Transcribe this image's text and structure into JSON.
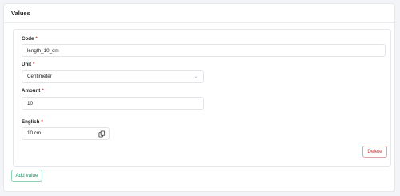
{
  "section": {
    "title": "Values"
  },
  "form": {
    "code": {
      "label": "Code",
      "required_mark": "*",
      "value": "length_10_cm"
    },
    "unit": {
      "label": "Unit",
      "required_mark": "*",
      "value": "Centimeter",
      "chevron": "⌄"
    },
    "amount": {
      "label": "Amount",
      "required_mark": "*",
      "value": "10"
    },
    "english": {
      "label": "English",
      "required_mark": "*",
      "value": "10 cm"
    }
  },
  "buttons": {
    "delete": "Delete",
    "add_value": "Add value"
  },
  "icons": {
    "copy": "copy-icon",
    "chevron": "chevron-down-icon"
  },
  "colors": {
    "required": "#d33b3b",
    "delete": "#c7423f",
    "add": "#1f8f63"
  }
}
